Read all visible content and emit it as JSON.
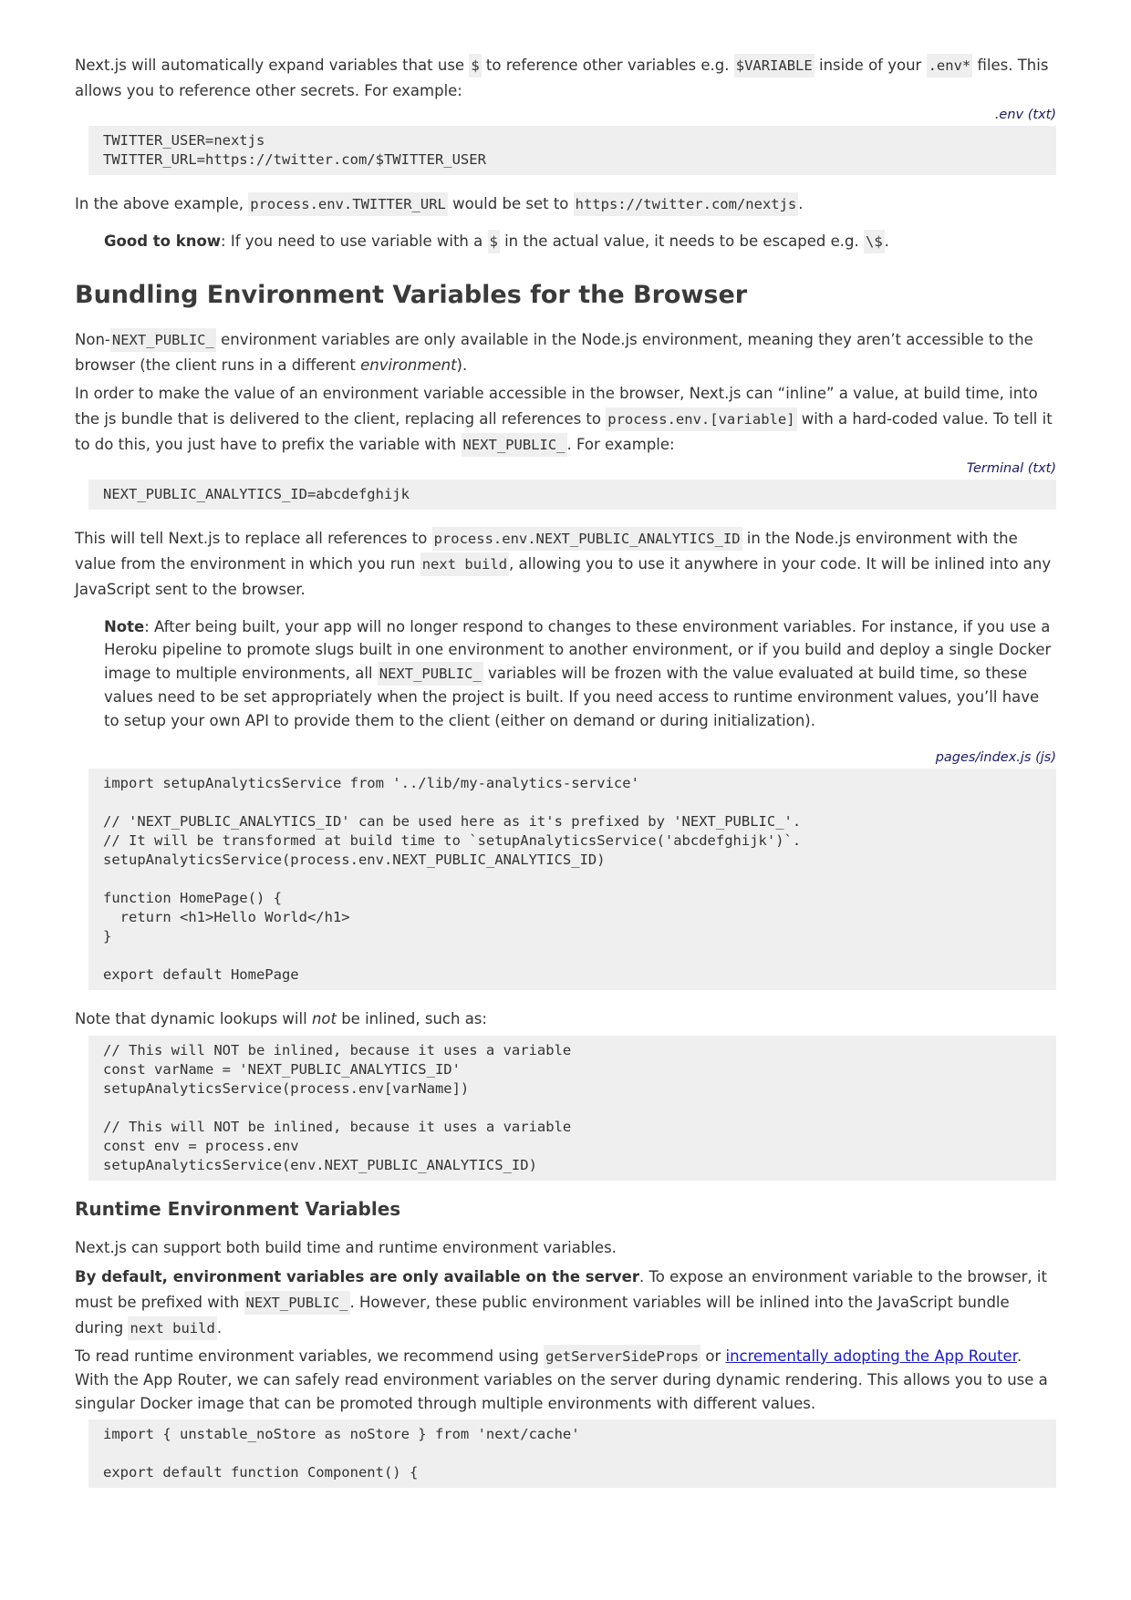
{
  "expand": {
    "t1": "Next.js will automatically expand variables that use ",
    "c1": "$",
    "t2": " to reference other variables e.g. ",
    "c2": "$VARIABLE",
    "t3": " inside of your ",
    "c3": ".env*",
    "t4": " files. This allows you to reference other secrets. For example:"
  },
  "code1": {
    "caption": ".env (txt)",
    "content": "TWITTER_USER=nextjs\nTWITTER_URL=https://twitter.com/$TWITTER_USER"
  },
  "example": {
    "t1": "In the above example, ",
    "c1": "process.env.TWITTER_URL",
    "t2": " would be set to ",
    "c2": "https://twitter.com/nextjs",
    "t3": "."
  },
  "gtk": {
    "label": "Good to know",
    "t1": ": If you need to use variable with a ",
    "c1": "$",
    "t2": " in the actual value, it needs to be escaped e.g. ",
    "c2": "\\$",
    "t3": "."
  },
  "h_bundling": "Bundling Environment Variables for the Browser",
  "nonpublic": {
    "t1": "Non-",
    "c1": "NEXT_PUBLIC_",
    "t2": " environment variables are only available in the Node.js environment, meaning they aren’t accessible to the browser (the client runs in a different ",
    "em": "environment",
    "t3": ")."
  },
  "inline_para": {
    "t1": "In order to make the value of an environment variable accessible in the browser, Next.js can “inline” a value, at build time, into the js bundle that is delivered to the client, replacing all references to ",
    "c1": "process.env.[variable]",
    "t2": " with a hard-coded value. To tell it to do this, you just have to prefix the variable with ",
    "c2": "NEXT_PUBLIC_",
    "t3": ". For example:"
  },
  "code2": {
    "caption": "Terminal (txt)",
    "content": "NEXT_PUBLIC_ANALYTICS_ID=abcdefghijk"
  },
  "replace_para": {
    "t1": "This will tell Next.js to replace all references to ",
    "c1": "process.env.NEXT_PUBLIC_ANALYTICS_ID",
    "t2": " in the Node.js environment with the value from the environment in which you run ",
    "c2": "next build",
    "t3": ", allowing you to use it anywhere in your code. It will be inlined into any JavaScript sent to the browser."
  },
  "note": {
    "label": "Note",
    "t1": ": After being built, your app will no longer respond to changes to these environment variables. For instance, if you use a Heroku pipeline to promote slugs built in one environment to another environment, or if you build and deploy a single Docker image to multiple environments, all ",
    "c1": "NEXT_PUBLIC_",
    "t2": " variables will be frozen with the value evaluated at build time, so these values need to be set appropriately when the project is built. If you need access to runtime environment values, you’ll have to setup your own API to provide them to the client (either on demand or during initialization)."
  },
  "code3": {
    "caption": "pages/index.js (js)",
    "content": "import setupAnalyticsService from '../lib/my-analytics-service'\n\n// 'NEXT_PUBLIC_ANALYTICS_ID' can be used here as it's prefixed by 'NEXT_PUBLIC_'.\n// It will be transformed at build time to `setupAnalyticsService('abcdefghijk')`.\nsetupAnalyticsService(process.env.NEXT_PUBLIC_ANALYTICS_ID)\n\nfunction HomePage() {\n  return <h1>Hello World</h1>\n}\n\nexport default HomePage"
  },
  "dynamic": {
    "t1": "Note that dynamic lookups will ",
    "em": "not",
    "t2": " be inlined, such as:"
  },
  "code4": {
    "content": "// This will NOT be inlined, because it uses a variable\nconst varName = 'NEXT_PUBLIC_ANALYTICS_ID'\nsetupAnalyticsService(process.env[varName])\n\n// This will NOT be inlined, because it uses a variable\nconst env = process.env\nsetupAnalyticsService(env.NEXT_PUBLIC_ANALYTICS_ID)"
  },
  "h_runtime": "Runtime Environment Variables",
  "support": "Next.js can support both build time and runtime environment variables.",
  "default_para": {
    "bold": "By default, environment variables are only available on the server",
    "t1": ". To expose an environment variable to the browser, it must be prefixed with ",
    "c1": "NEXT_PUBLIC_",
    "t2": ". However, these public environment variables will be inlined into the JavaScript bundle during ",
    "c2": "next build",
    "t3": "."
  },
  "read_para": {
    "t1": "To read runtime environment variables, we recommend using ",
    "c1": "getServerSideProps",
    "t2": " or ",
    "link": "incrementally adopting the App Router",
    "t3": ". With the App Router, we can safely read environment variables on the server during dynamic rendering. This allows you to use a singular Docker image that can be promoted through multiple environments with different values."
  },
  "code5": {
    "content": "import { unstable_noStore as noStore } from 'next/cache'\n\nexport default function Component() {"
  }
}
